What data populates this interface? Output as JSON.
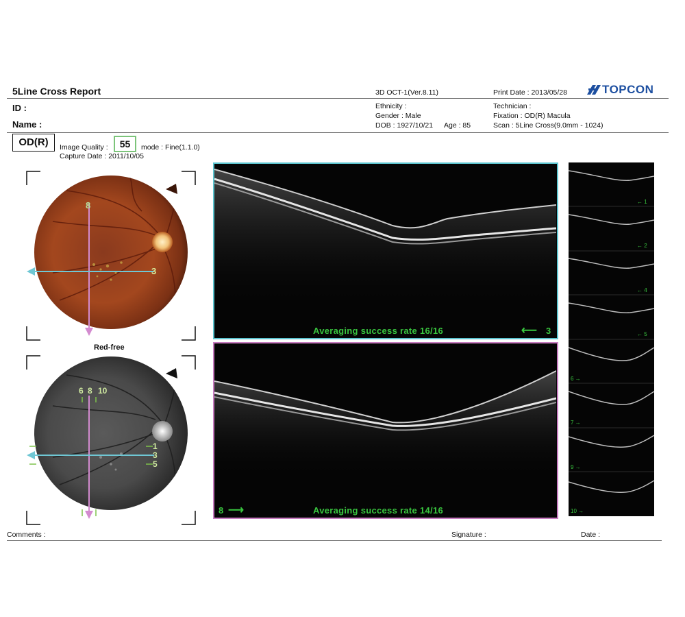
{
  "report": {
    "title": "5Line Cross Report",
    "device": "3D OCT-1(Ver.8.11)",
    "print_date": "Print Date : 2013/05/28",
    "brand": "TOPCON"
  },
  "patient": {
    "id_label": "ID :",
    "name_label": "Name :",
    "ethnicity": "Ethnicity :",
    "gender": "Gender : Male",
    "dob": "DOB : 1927/10/21",
    "age": "Age : 85"
  },
  "exam": {
    "technician": "Technician :",
    "fixation": "Fixation : OD(R) Macula",
    "scan": "Scan : 5Line Cross(9.0mm - 1024)",
    "eye": "OD(R)",
    "image_quality_label": "Image Quality :",
    "image_quality_value": "55",
    "mode": "mode : Fine(1.1.0)",
    "capture_date": "Capture Date : 2011/10/05"
  },
  "fundus": {
    "color_labels": {
      "vertical": "8",
      "horizontal": "3"
    },
    "redfree_title": "Red-free",
    "redfree_top_labels": [
      "6",
      "8",
      "10"
    ],
    "redfree_right_labels": [
      "1",
      "3",
      "5"
    ]
  },
  "oct": {
    "top_caption": "Averaging success rate 16/16",
    "top_line": "3",
    "bottom_caption": "Averaging success rate 14/16",
    "bottom_line": "8",
    "accent_horizontal": "#5bc4cf",
    "accent_vertical": "#c77bc0",
    "text_color": "#39c53f"
  },
  "thumbnails": {
    "labels": [
      "1",
      "2",
      "4",
      "5",
      "6",
      "7",
      "9",
      "10"
    ]
  },
  "footer": {
    "comments": "Comments :",
    "signature": "Signature :",
    "date": "Date :"
  }
}
